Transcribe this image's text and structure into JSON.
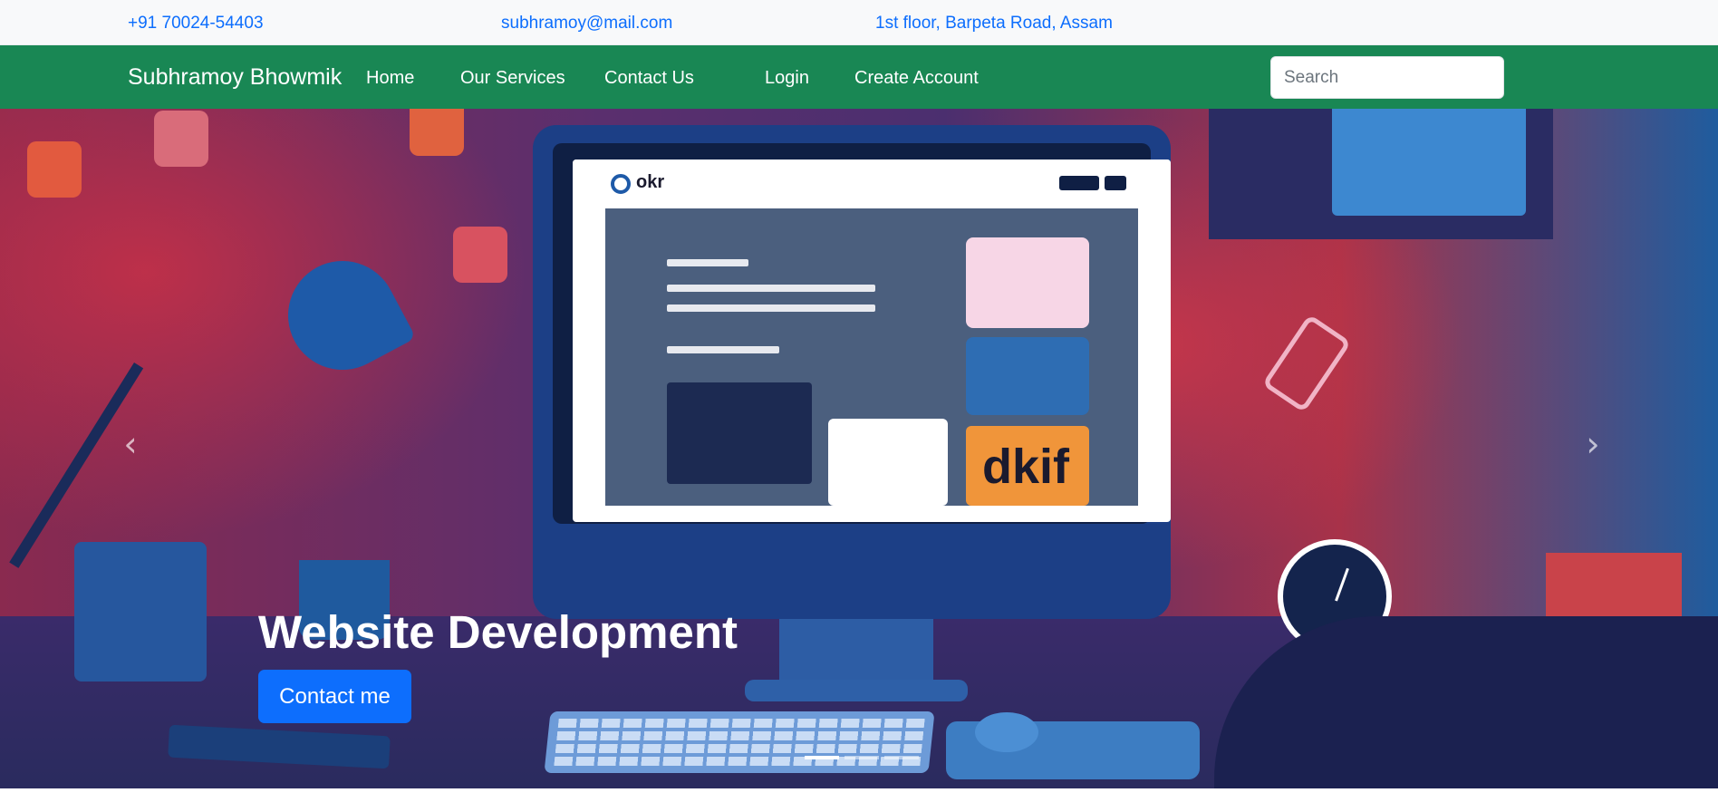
{
  "topbar": {
    "phone": "+91 70024-54403",
    "email": "subhramoy@mail.com",
    "address": "1st floor, Barpeta Road, Assam"
  },
  "navbar": {
    "brand": "Subhramoy Bhowmik",
    "links": [
      "Home",
      "Our Services",
      "Contact Us",
      "Login",
      "Create Account"
    ],
    "search_placeholder": "Search",
    "background_color": "#198754"
  },
  "carousel": {
    "slide_title": "Website Development",
    "button_label": "Contact me",
    "button_color": "#0d6efd",
    "active_indicator": 0,
    "indicator_count": 3,
    "illustration": {
      "screen_logo_text": "okr",
      "screen_card_text": "dkif"
    }
  }
}
